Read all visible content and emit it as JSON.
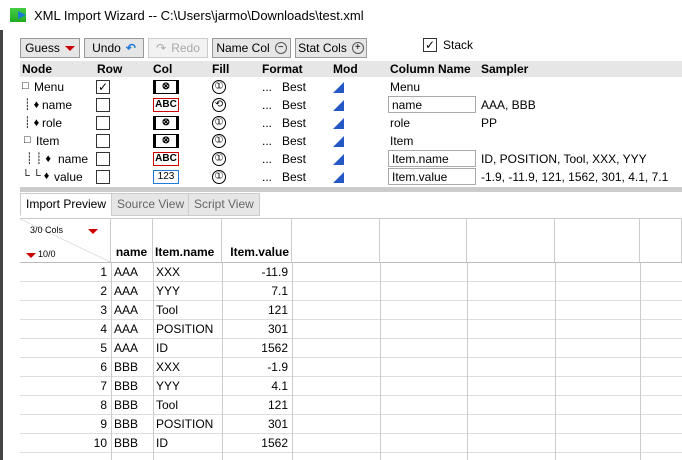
{
  "window": {
    "title": "XML Import Wizard -- C:\\Users\\jarmo\\Downloads\\test.xml"
  },
  "toolbar": {
    "guess": "Guess",
    "undo": "Undo",
    "redo": "Redo",
    "name_col": "Name Col",
    "stat_cols": "Stat Cols",
    "stack": "Stack",
    "stack_checked": true
  },
  "tree": {
    "headers": [
      "Node",
      "Row",
      "Col",
      "Fill",
      "Format",
      "Mod",
      "Column Name",
      "Sampler"
    ],
    "rows": [
      {
        "node": "Menu",
        "row": "✓",
        "col": "",
        "fill": "①",
        "format_dots": "...",
        "format": "Best",
        "column_name": "Menu",
        "sampler": ""
      },
      {
        "node": "name",
        "row": "",
        "col": "ABC",
        "fill": "⟲",
        "format_dots": "...",
        "format": "Best",
        "column_name": "name",
        "sampler": "AAA, BBB"
      },
      {
        "node": "role",
        "row": "",
        "col": "",
        "fill": "①",
        "format_dots": "...",
        "format": "Best",
        "column_name": "role",
        "sampler": "PP"
      },
      {
        "node": "Item",
        "row": "",
        "col": "",
        "fill": "①",
        "format_dots": "...",
        "format": "Best",
        "column_name": "Item",
        "sampler": ""
      },
      {
        "node": "name",
        "row": "",
        "col": "ABC",
        "fill": "①",
        "format_dots": "...",
        "format": "Best",
        "column_name": "Item.name",
        "sampler": "ID, POSITION, Tool, XXX, YYY"
      },
      {
        "node": "value",
        "row": "",
        "col": "123",
        "fill": "①",
        "format_dots": "...",
        "format": "Best",
        "column_name": "Item.value",
        "sampler": "-1.9, -11.9, 121, 1562, 301, 4.1, 7.1"
      }
    ]
  },
  "tabs": [
    "Import Preview",
    "Source View",
    "Script View"
  ],
  "preview": {
    "cols_label": "3/0 Cols",
    "rows_label": "10/0",
    "headers": [
      "name",
      "Item.name",
      "Item.value"
    ],
    "rows": [
      [
        "1",
        "AAA",
        "XXX",
        "-11.9"
      ],
      [
        "2",
        "AAA",
        "YYY",
        "7.1"
      ],
      [
        "3",
        "AAA",
        "Tool",
        "121"
      ],
      [
        "4",
        "AAA",
        "POSITION",
        "301"
      ],
      [
        "5",
        "AAA",
        "ID",
        "1562"
      ],
      [
        "6",
        "BBB",
        "XXX",
        "-1.9"
      ],
      [
        "7",
        "BBB",
        "YYY",
        "4.1"
      ],
      [
        "8",
        "BBB",
        "Tool",
        "121"
      ],
      [
        "9",
        "BBB",
        "POSITION",
        "301"
      ],
      [
        "10",
        "BBB",
        "ID",
        "1562"
      ]
    ]
  }
}
